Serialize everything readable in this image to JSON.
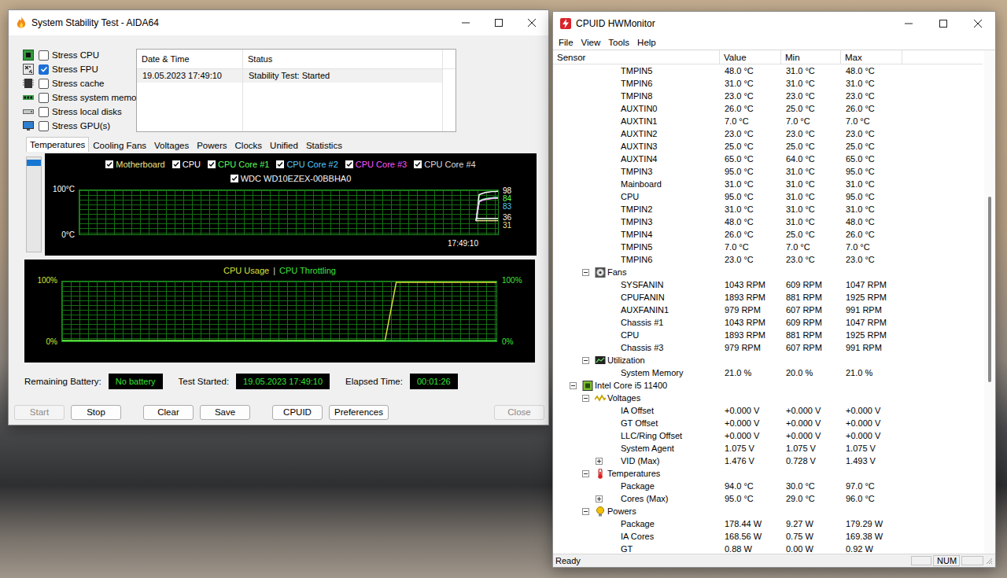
{
  "aida": {
    "title": "System Stability Test - AIDA64",
    "stress_options": [
      {
        "label": "Stress CPU",
        "checked": false,
        "kind": "cpu"
      },
      {
        "label": "Stress FPU",
        "checked": true,
        "kind": "fpu"
      },
      {
        "label": "Stress cache",
        "checked": false,
        "kind": "cache"
      },
      {
        "label": "Stress system memory",
        "checked": false,
        "kind": "memory"
      },
      {
        "label": "Stress local disks",
        "checked": false,
        "kind": "disk"
      },
      {
        "label": "Stress GPU(s)",
        "checked": false,
        "kind": "gpu"
      }
    ],
    "log": {
      "columns": [
        "Date & Time",
        "Status"
      ],
      "rows": [
        [
          "19.05.2023 17:49:10",
          "Stability Test: Started"
        ]
      ]
    },
    "tabs": [
      {
        "label": "Temperatures",
        "selected": true
      },
      {
        "label": "Cooling Fans",
        "selected": false
      },
      {
        "label": "Voltages",
        "selected": false
      },
      {
        "label": "Powers",
        "selected": false
      },
      {
        "label": "Clocks",
        "selected": false
      },
      {
        "label": "Unified",
        "selected": false
      },
      {
        "label": "Statistics",
        "selected": false
      }
    ],
    "chart_scroller": {
      "level": 0.07
    },
    "temperature_chart": {
      "y_max": "100°C",
      "y_min": "0°C",
      "time": "17:49:10",
      "series": [
        {
          "name": "Motherboard",
          "checked": true,
          "color": "#ece48c",
          "values": [
            31,
            31,
            31,
            31,
            31,
            31,
            31,
            31
          ],
          "reading": "31"
        },
        {
          "name": "CPU",
          "checked": true,
          "color": "#ffffff",
          "values": [
            31,
            90,
            93,
            95,
            96,
            97,
            97,
            98
          ],
          "reading": "98"
        },
        {
          "name": "CPU Core #1",
          "checked": true,
          "color": "#5cff5c",
          "values": [
            30,
            76,
            79,
            81,
            82,
            83,
            84,
            84
          ],
          "reading": "84"
        },
        {
          "name": "CPU Core #2",
          "checked": true,
          "color": "#55ccff",
          "values": [
            30,
            75,
            78,
            80,
            81,
            82,
            83,
            83
          ],
          "reading": "83"
        },
        {
          "name": "CPU Core #3",
          "checked": true,
          "color": "#ff55ff",
          "values": [
            30,
            74,
            77,
            79,
            80,
            81,
            82,
            82
          ]
        },
        {
          "name": "CPU Core #4",
          "checked": true,
          "color": "#dcdcdc",
          "values": [
            30,
            75,
            78,
            80,
            81,
            82,
            82,
            82
          ]
        },
        {
          "name": "WDC WD10EZEX-00BBHA0",
          "checked": true,
          "color": "#f4f4f4",
          "values": [
            36,
            36,
            36,
            36,
            36,
            36,
            36,
            36
          ],
          "reading": "36"
        }
      ]
    },
    "usage_chart": {
      "y_max": "100%",
      "y_min": "0%",
      "y_max_right": "100%",
      "y_min_right": "0%",
      "separator": "|",
      "series": [
        {
          "name": "CPU Usage",
          "color": "#d8e03a",
          "values": [
            0,
            0,
            0,
            0,
            0,
            0,
            0,
            0,
            0,
            0,
            0,
            0,
            0,
            0,
            0,
            0,
            0,
            0,
            0,
            0,
            0,
            0,
            0,
            0,
            0,
            0,
            0,
            0,
            0,
            0,
            100,
            100,
            100,
            100,
            100,
            100,
            100,
            100,
            100,
            100
          ]
        },
        {
          "name": "CPU Throttling",
          "color": "#3ee03e",
          "values": [
            0,
            0,
            0,
            0,
            0,
            0,
            0,
            0,
            0,
            0,
            0,
            0,
            0,
            0,
            0,
            0,
            0,
            0,
            0,
            0,
            0,
            0,
            0,
            0,
            0,
            0,
            0,
            0,
            0,
            0,
            0,
            0,
            0,
            0,
            0,
            0,
            0,
            0,
            0,
            0
          ]
        }
      ]
    },
    "info": [
      {
        "label": "Remaining Battery:",
        "value": "No battery"
      },
      {
        "label": "Test Started:",
        "value": "19.05.2023 17:49:10"
      },
      {
        "label": "Elapsed Time:",
        "value": "00:01:26"
      }
    ],
    "buttons": [
      {
        "label": "Start",
        "disabled": true
      },
      {
        "label": "Stop",
        "disabled": false
      },
      {
        "label": "Clear",
        "disabled": false
      },
      {
        "label": "Save",
        "disabled": false
      },
      {
        "label": "CPUID",
        "disabled": false
      },
      {
        "label": "Preferences",
        "disabled": false
      },
      {
        "label": "Close",
        "disabled": true
      }
    ]
  },
  "hwmonitor": {
    "title": "CPUID HWMonitor",
    "menu": [
      "File",
      "View",
      "Tools",
      "Help"
    ],
    "columns": [
      "Sensor",
      "Value",
      "Min",
      "Max"
    ],
    "scrollbar": {
      "offset": 0.29,
      "size": 0.37
    },
    "rows": [
      {
        "kind": "sensor",
        "label": "TMPIN5",
        "value": "48.0 °C",
        "min": "31.0 °C",
        "max": "48.0 °C"
      },
      {
        "kind": "sensor",
        "label": "TMPIN6",
        "value": "31.0 °C",
        "min": "31.0 °C",
        "max": "31.0 °C"
      },
      {
        "kind": "sensor",
        "label": "TMPIN8",
        "value": "23.0 °C",
        "min": "23.0 °C",
        "max": "23.0 °C"
      },
      {
        "kind": "sensor",
        "label": "AUXTIN0",
        "value": "26.0 °C",
        "min": "25.0 °C",
        "max": "26.0 °C"
      },
      {
        "kind": "sensor",
        "label": "AUXTIN1",
        "value": "7.0 °C",
        "min": "7.0 °C",
        "max": "7.0 °C"
      },
      {
        "kind": "sensor",
        "label": "AUXTIN2",
        "value": "23.0 °C",
        "min": "23.0 °C",
        "max": "23.0 °C"
      },
      {
        "kind": "sensor",
        "label": "AUXTIN3",
        "value": "25.0 °C",
        "min": "25.0 °C",
        "max": "25.0 °C"
      },
      {
        "kind": "sensor",
        "label": "AUXTIN4",
        "value": "65.0 °C",
        "min": "64.0 °C",
        "max": "65.0 °C"
      },
      {
        "kind": "sensor",
        "label": "TMPIN3",
        "value": "95.0 °C",
        "min": "31.0 °C",
        "max": "95.0 °C"
      },
      {
        "kind": "sensor",
        "label": "Mainboard",
        "value": "31.0 °C",
        "min": "31.0 °C",
        "max": "31.0 °C"
      },
      {
        "kind": "sensor",
        "label": "CPU",
        "value": "95.0 °C",
        "min": "31.0 °C",
        "max": "95.0 °C"
      },
      {
        "kind": "sensor",
        "label": "TMPIN2",
        "value": "31.0 °C",
        "min": "31.0 °C",
        "max": "31.0 °C"
      },
      {
        "kind": "sensor",
        "label": "TMPIN3",
        "value": "48.0 °C",
        "min": "31.0 °C",
        "max": "48.0 °C"
      },
      {
        "kind": "sensor",
        "label": "TMPIN4",
        "value": "26.0 °C",
        "min": "25.0 °C",
        "max": "26.0 °C"
      },
      {
        "kind": "sensor",
        "label": "TMPIN5",
        "value": "7.0 °C",
        "min": "7.0 °C",
        "max": "7.0 °C"
      },
      {
        "kind": "sensor",
        "label": "TMPIN6",
        "value": "23.0 °C",
        "min": "23.0 °C",
        "max": "23.0 °C"
      },
      {
        "kind": "fans",
        "label": "Fans",
        "expanded": true
      },
      {
        "kind": "sensor",
        "label": "SYSFANIN",
        "value": "1043 RPM",
        "min": "609 RPM",
        "max": "1047 RPM"
      },
      {
        "kind": "sensor",
        "label": "CPUFANIN",
        "value": "1893 RPM",
        "min": "881 RPM",
        "max": "1925 RPM"
      },
      {
        "kind": "sensor",
        "label": "AUXFANIN1",
        "value": "979 RPM",
        "min": "607 RPM",
        "max": "991 RPM"
      },
      {
        "kind": "sensor",
        "label": "Chassis #1",
        "value": "1043 RPM",
        "min": "609 RPM",
        "max": "1047 RPM"
      },
      {
        "kind": "sensor",
        "label": "CPU",
        "value": "1893 RPM",
        "min": "881 RPM",
        "max": "1925 RPM"
      },
      {
        "kind": "sensor",
        "label": "Chassis #3",
        "value": "979 RPM",
        "min": "607 RPM",
        "max": "991 RPM"
      },
      {
        "kind": "utilization",
        "label": "Utilization",
        "expanded": true
      },
      {
        "kind": "sensor",
        "label": "System Memory",
        "value": "21.0 %",
        "min": "20.0 %",
        "max": "21.0 %"
      },
      {
        "kind": "device",
        "label": "Intel Core i5 11400",
        "expanded": true
      },
      {
        "kind": "voltages",
        "label": "Voltages",
        "expanded": true
      },
      {
        "kind": "sensor",
        "label": "IA Offset",
        "value": "+0.000 V",
        "min": "+0.000 V",
        "max": "+0.000 V"
      },
      {
        "kind": "sensor",
        "label": "GT Offset",
        "value": "+0.000 V",
        "min": "+0.000 V",
        "max": "+0.000 V"
      },
      {
        "kind": "sensor",
        "label": "LLC/Ring Offset",
        "value": "+0.000 V",
        "min": "+0.000 V",
        "max": "+0.000 V"
      },
      {
        "kind": "sensor",
        "label": "System Agent",
        "value": "1.075 V",
        "min": "1.075 V",
        "max": "1.075 V"
      },
      {
        "kind": "sensor",
        "label": "VID (Max)",
        "value": "1.476 V",
        "min": "0.728 V",
        "max": "1.493 V",
        "expanded": false
      },
      {
        "kind": "temperatures",
        "label": "Temperatures",
        "expanded": true
      },
      {
        "kind": "sensor",
        "label": "Package",
        "value": "94.0 °C",
        "min": "30.0 °C",
        "max": "97.0 °C"
      },
      {
        "kind": "sensor",
        "label": "Cores (Max)",
        "value": "95.0 °C",
        "min": "29.0 °C",
        "max": "96.0 °C",
        "expanded": false
      },
      {
        "kind": "powers",
        "label": "Powers",
        "expanded": true
      },
      {
        "kind": "sensor",
        "label": "Package",
        "value": "178.44 W",
        "min": "9.27 W",
        "max": "179.29 W"
      },
      {
        "kind": "sensor",
        "label": "IA Cores",
        "value": "168.56 W",
        "min": "0.75 W",
        "max": "169.38 W"
      },
      {
        "kind": "sensor",
        "label": "GT",
        "value": "0.88 W",
        "min": "0.00 W",
        "max": "0.92 W"
      }
    ],
    "status_bar": {
      "text": "Ready",
      "indicators": [
        "",
        "NUM",
        ""
      ]
    }
  }
}
